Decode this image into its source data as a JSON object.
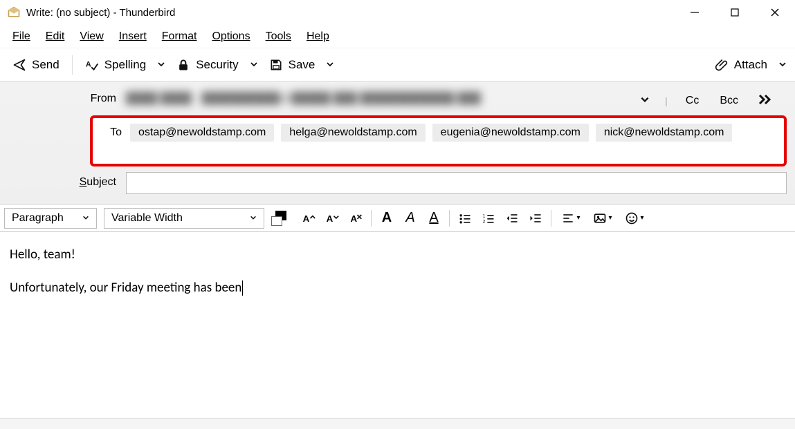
{
  "window": {
    "title": "Write: (no subject) - Thunderbird"
  },
  "menu": {
    "file": "File",
    "edit": "Edit",
    "view": "View",
    "insert": "Insert",
    "format": "Format",
    "options": "Options",
    "tools": "Tools",
    "help": "Help"
  },
  "toolbar": {
    "send": "Send",
    "spelling": "Spelling",
    "security": "Security",
    "save": "Save",
    "attach": "Attach"
  },
  "fields": {
    "from_label": "From",
    "from_value_masked": "████ ████ · ██████████@█████.███  ████████████.███",
    "cc": "Cc",
    "bcc": "Bcc",
    "to_label": "To",
    "to_recipients": [
      "ostap@newoldstamp.com",
      "helga@newoldstamp.com",
      "eugenia@newoldstamp.com",
      "nick@newoldstamp.com"
    ],
    "subject_label": "Subject",
    "subject_value": ""
  },
  "format": {
    "paragraph": "Paragraph",
    "font": "Variable Width"
  },
  "body": {
    "line1": "Hello, team!",
    "line2": "Unfortunately, our Friday meeting has been"
  }
}
